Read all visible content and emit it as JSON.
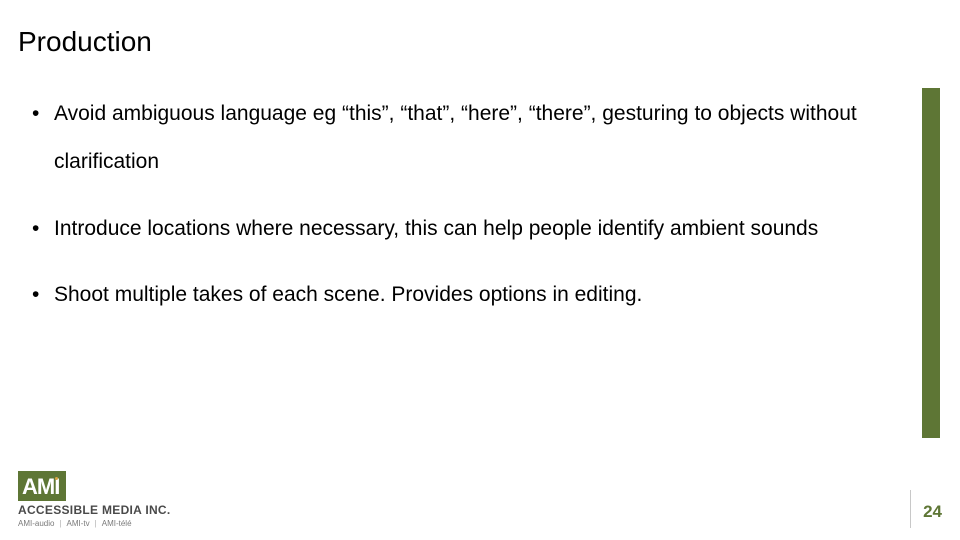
{
  "title": "Production",
  "bullets": [
    "Avoid ambiguous language eg “this”, “that”, “here”, “there”, gesturing to objects without clarification",
    "Introduce locations where necessary, this can help people identify ambient sounds",
    "Shoot multiple takes of each scene. Provides options in editing."
  ],
  "footer": {
    "logo_text": "AMI",
    "company_name": "ACCESSIBLE MEDIA INC.",
    "sub_brands": [
      "AMI-audio",
      "AMI-tv",
      "AMI-télé"
    ]
  },
  "page_number": "24",
  "colors": {
    "accent": "#5e7635"
  }
}
